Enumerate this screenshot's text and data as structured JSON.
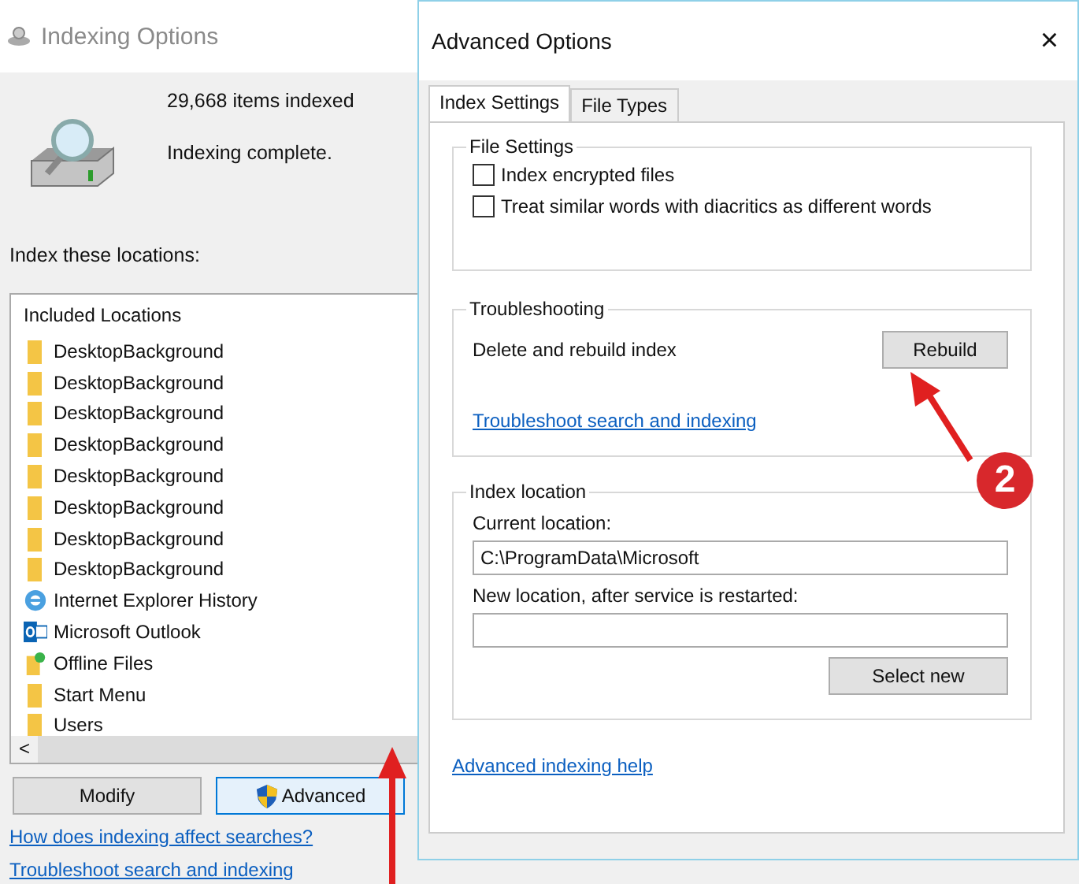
{
  "indexing_window": {
    "title": "Indexing Options",
    "items_indexed": "29,668 items indexed",
    "status": "Indexing complete.",
    "locations_label": "Index these locations:",
    "list_header": "Included Locations",
    "locations": [
      {
        "name": "DesktopBackground",
        "kind": "folder"
      },
      {
        "name": "DesktopBackground",
        "kind": "folder"
      },
      {
        "name": "DesktopBackground",
        "kind": "folder"
      },
      {
        "name": "DesktopBackground",
        "kind": "folder"
      },
      {
        "name": "DesktopBackground",
        "kind": "folder"
      },
      {
        "name": "DesktopBackground",
        "kind": "folder"
      },
      {
        "name": "DesktopBackground",
        "kind": "folder"
      },
      {
        "name": "DesktopBackground",
        "kind": "folder"
      },
      {
        "name": "Internet Explorer History",
        "kind": "browser"
      },
      {
        "name": "Microsoft Outlook",
        "kind": "mail"
      },
      {
        "name": "Offline Files",
        "kind": "sync"
      },
      {
        "name": "Start Menu",
        "kind": "folder"
      },
      {
        "name": "Users",
        "kind": "folder"
      }
    ],
    "scroll_left": "<",
    "buttons": [
      {
        "label": "Modify",
        "kind": "plain"
      },
      {
        "label": "Advanced",
        "kind": "shield"
      }
    ],
    "links": [
      "How does indexing affect searches?",
      "Troubleshoot search and indexing"
    ]
  },
  "advanced_dialog": {
    "title": "Advanced Options",
    "close": "×",
    "tabs": [
      {
        "label": "Index Settings",
        "selected": true
      },
      {
        "label": "File Types",
        "selected": false
      }
    ],
    "file_settings": {
      "title": "File Settings",
      "options": [
        {
          "label": "Index encrypted files",
          "checked": false
        },
        {
          "label": "Treat similar words with diacritics as different words",
          "checked": false
        }
      ]
    },
    "troubleshooting": {
      "title": "Troubleshooting",
      "rebuild_label": "Delete and rebuild index",
      "rebuild_button": "Rebuild",
      "link": "Troubleshoot search and indexing"
    },
    "index_location": {
      "title": "Index location",
      "current_label": "Current location:",
      "current_value": "C:\\ProgramData\\Microsoft",
      "new_label": "New location, after service is restarted:",
      "select_button": "Select new"
    },
    "help_link": "Advanced indexing help"
  },
  "annotation": {
    "step": "2"
  }
}
